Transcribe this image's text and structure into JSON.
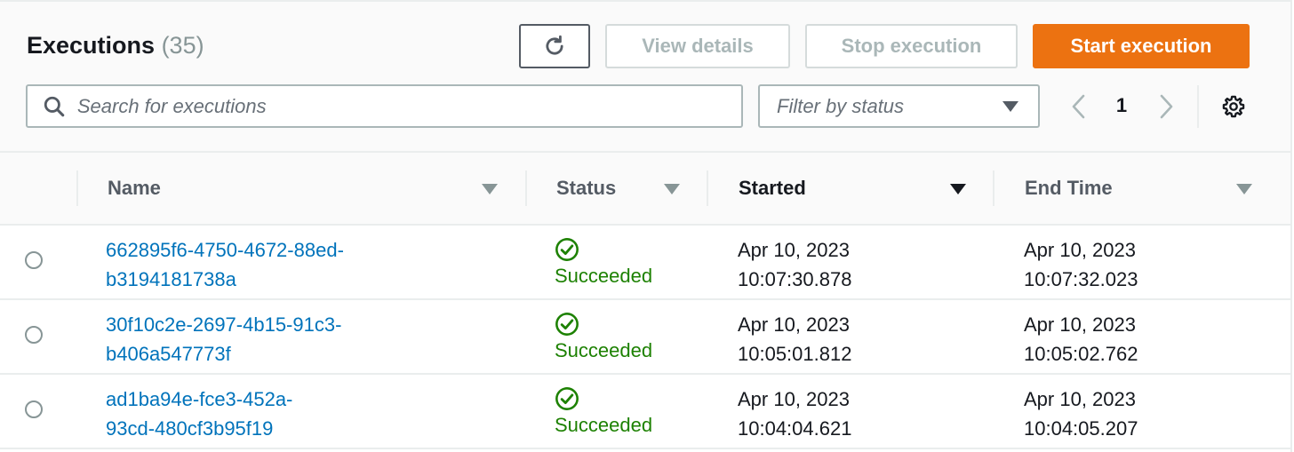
{
  "header": {
    "title": "Executions",
    "count": "(35)"
  },
  "toolbar": {
    "view_details_label": "View details",
    "stop_execution_label": "Stop execution",
    "start_execution_label": "Start execution"
  },
  "search": {
    "placeholder": "Search for executions"
  },
  "filter": {
    "placeholder": "Filter by status"
  },
  "pagination": {
    "current_page": "1"
  },
  "table": {
    "columns": [
      {
        "label": "Name"
      },
      {
        "label": "Status"
      },
      {
        "label": "Started"
      },
      {
        "label": "End Time"
      }
    ],
    "rows": [
      {
        "name_line1": "662895f6-4750-4672-88ed-",
        "name_line2": "b3194181738a",
        "status": "Succeeded",
        "started_date": "Apr 10, 2023",
        "started_time": "10:07:30.878",
        "end_date": "Apr 10, 2023",
        "end_time": "10:07:32.023"
      },
      {
        "name_line1": "30f10c2e-2697-4b15-91c3-",
        "name_line2": "b406a547773f",
        "status": "Succeeded",
        "started_date": "Apr 10, 2023",
        "started_time": "10:05:01.812",
        "end_date": "Apr 10, 2023",
        "end_time": "10:05:02.762"
      },
      {
        "name_line1": "ad1ba94e-fce3-452a-",
        "name_line2": "93cd-480cf3b95f19",
        "status": "Succeeded",
        "started_date": "Apr 10, 2023",
        "started_time": "10:04:04.621",
        "end_date": "Apr 10, 2023",
        "end_time": "10:04:05.207"
      }
    ]
  },
  "colors": {
    "primary_button": "#ec7211",
    "link": "#0073bb",
    "success": "#1d8102",
    "disabled_text": "#aab7b8"
  },
  "icons": {
    "refresh": "refresh-icon",
    "search": "search-icon",
    "prev": "chevron-left-icon",
    "next": "chevron-right-icon",
    "settings": "gear-icon",
    "status": "check-circle-icon"
  }
}
